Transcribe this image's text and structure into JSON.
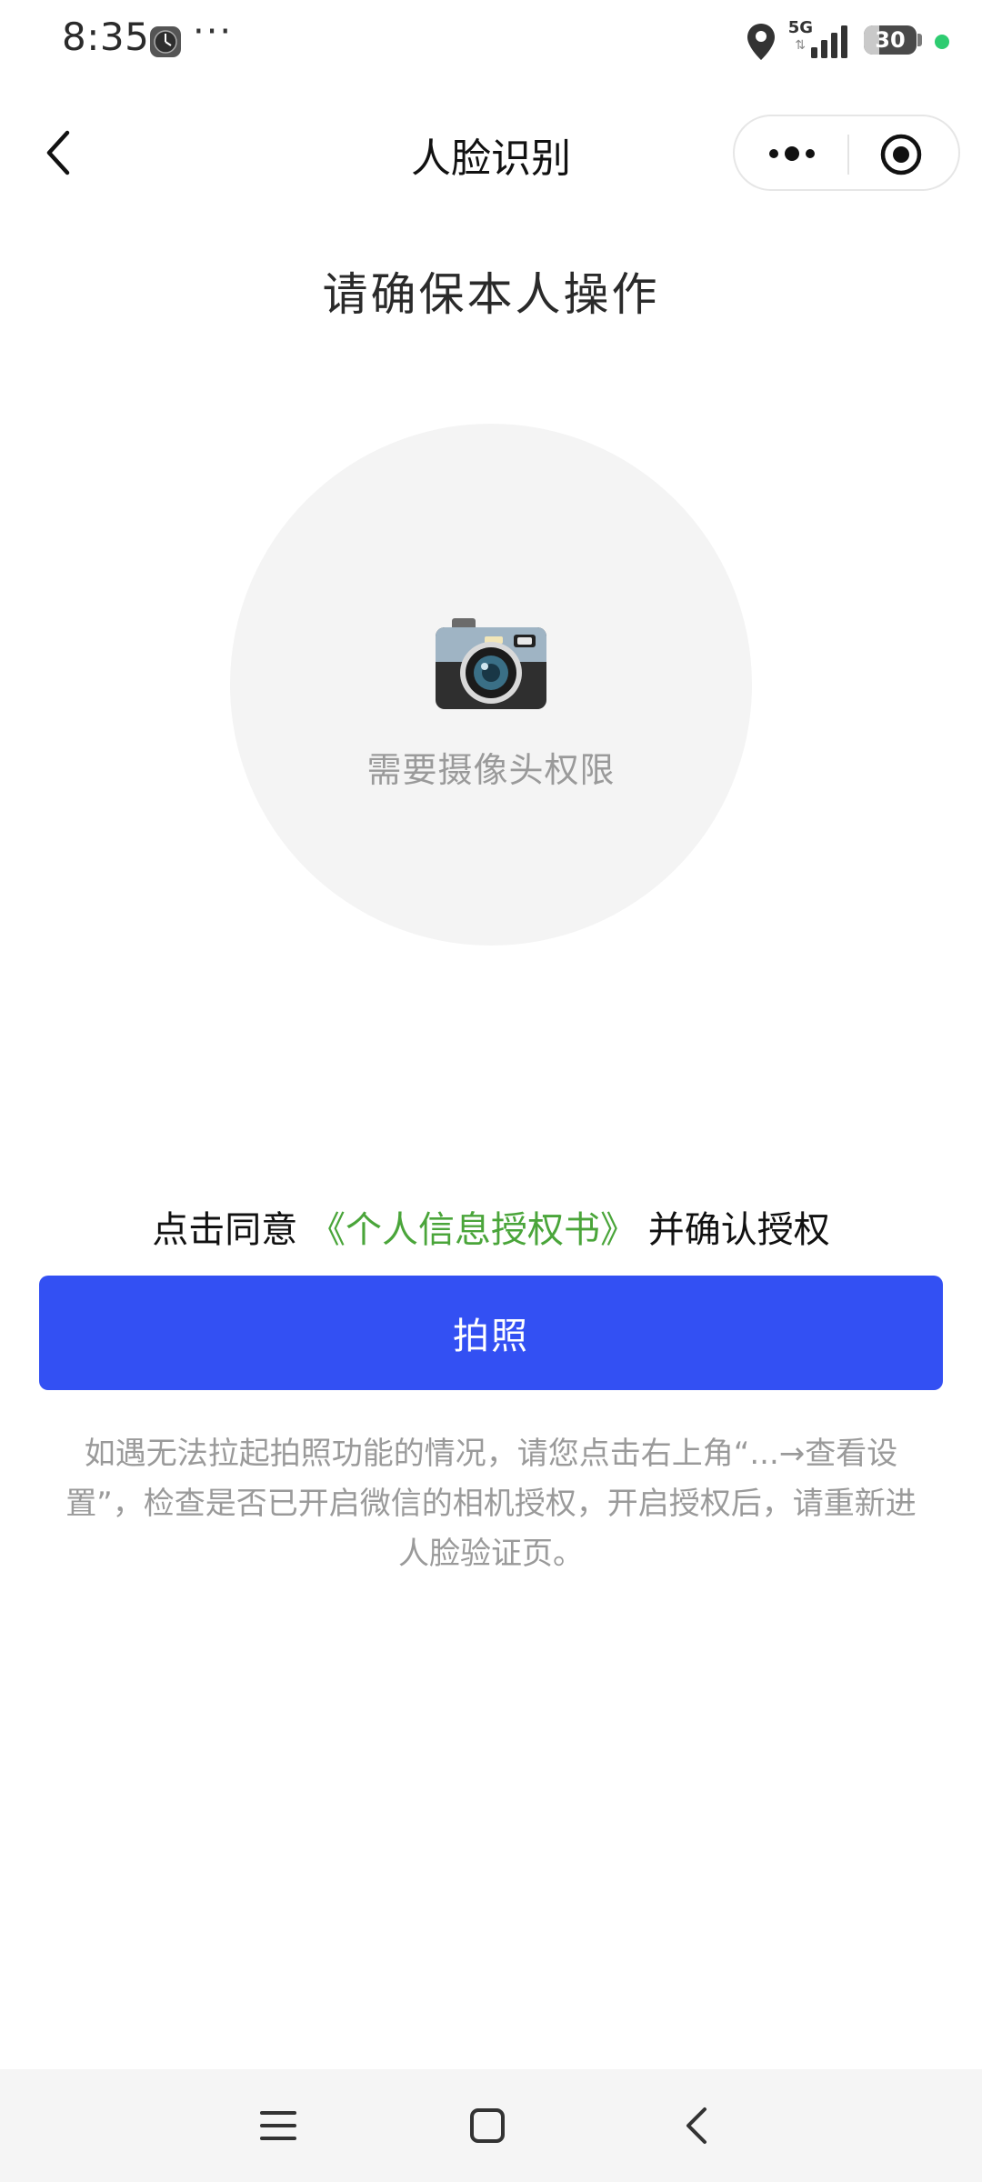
{
  "status_bar": {
    "time": "8:35",
    "more": "···",
    "network": "5G",
    "network_arrows": "⇅",
    "battery_level": "30",
    "battery_fraction": 0.3
  },
  "nav": {
    "title": "人脸识别",
    "icons": [
      "back-icon",
      "more-dots-icon",
      "close-target-icon"
    ]
  },
  "main": {
    "heading": "请确保本人操作",
    "camera_caption": "需要摄像头权限",
    "camera_icon": "camera-icon",
    "consent_prefix": "点击同意",
    "consent_link": "《个人信息授权书》",
    "consent_suffix": "并确认授权",
    "button_label": "拍照",
    "help_text": "如遇无法拉起拍照功能的情况，请您点击右上角“...→查看设置”，检查是否已开启微信的相机授权，开启授权后，请重新进人脸验证页。"
  },
  "colors": {
    "primary_button": "#3350f3",
    "link": "#4aa53a",
    "circle_bg": "#f4f4f4",
    "muted_text": "#9a9a9a"
  },
  "bottom_nav": {
    "icons": [
      "menu-icon",
      "home-square-icon",
      "back-chevron-icon"
    ]
  }
}
